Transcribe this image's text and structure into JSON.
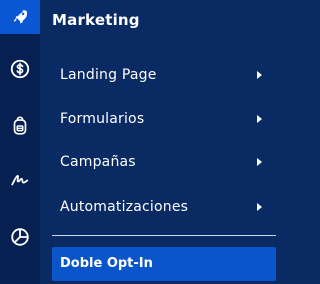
{
  "sidebar": {
    "icons": [
      {
        "name": "rocket-icon",
        "active": true
      },
      {
        "name": "dollar-icon",
        "active": false
      },
      {
        "name": "backpack-icon",
        "active": false
      },
      {
        "name": "signature-icon",
        "active": false
      },
      {
        "name": "pie-chart-icon",
        "active": false
      }
    ]
  },
  "panel": {
    "title": "Marketing",
    "items": [
      {
        "label": "Landing Page"
      },
      {
        "label": "Formularios"
      },
      {
        "label": "Campañas"
      },
      {
        "label": "Automatizaciones"
      }
    ],
    "selected_item": {
      "label": "Doble Opt-In"
    }
  },
  "colors": {
    "rail_bg": "#062052",
    "panel_bg": "#0a2a63",
    "accent": "#0a57d6",
    "text": "#ffffff"
  }
}
